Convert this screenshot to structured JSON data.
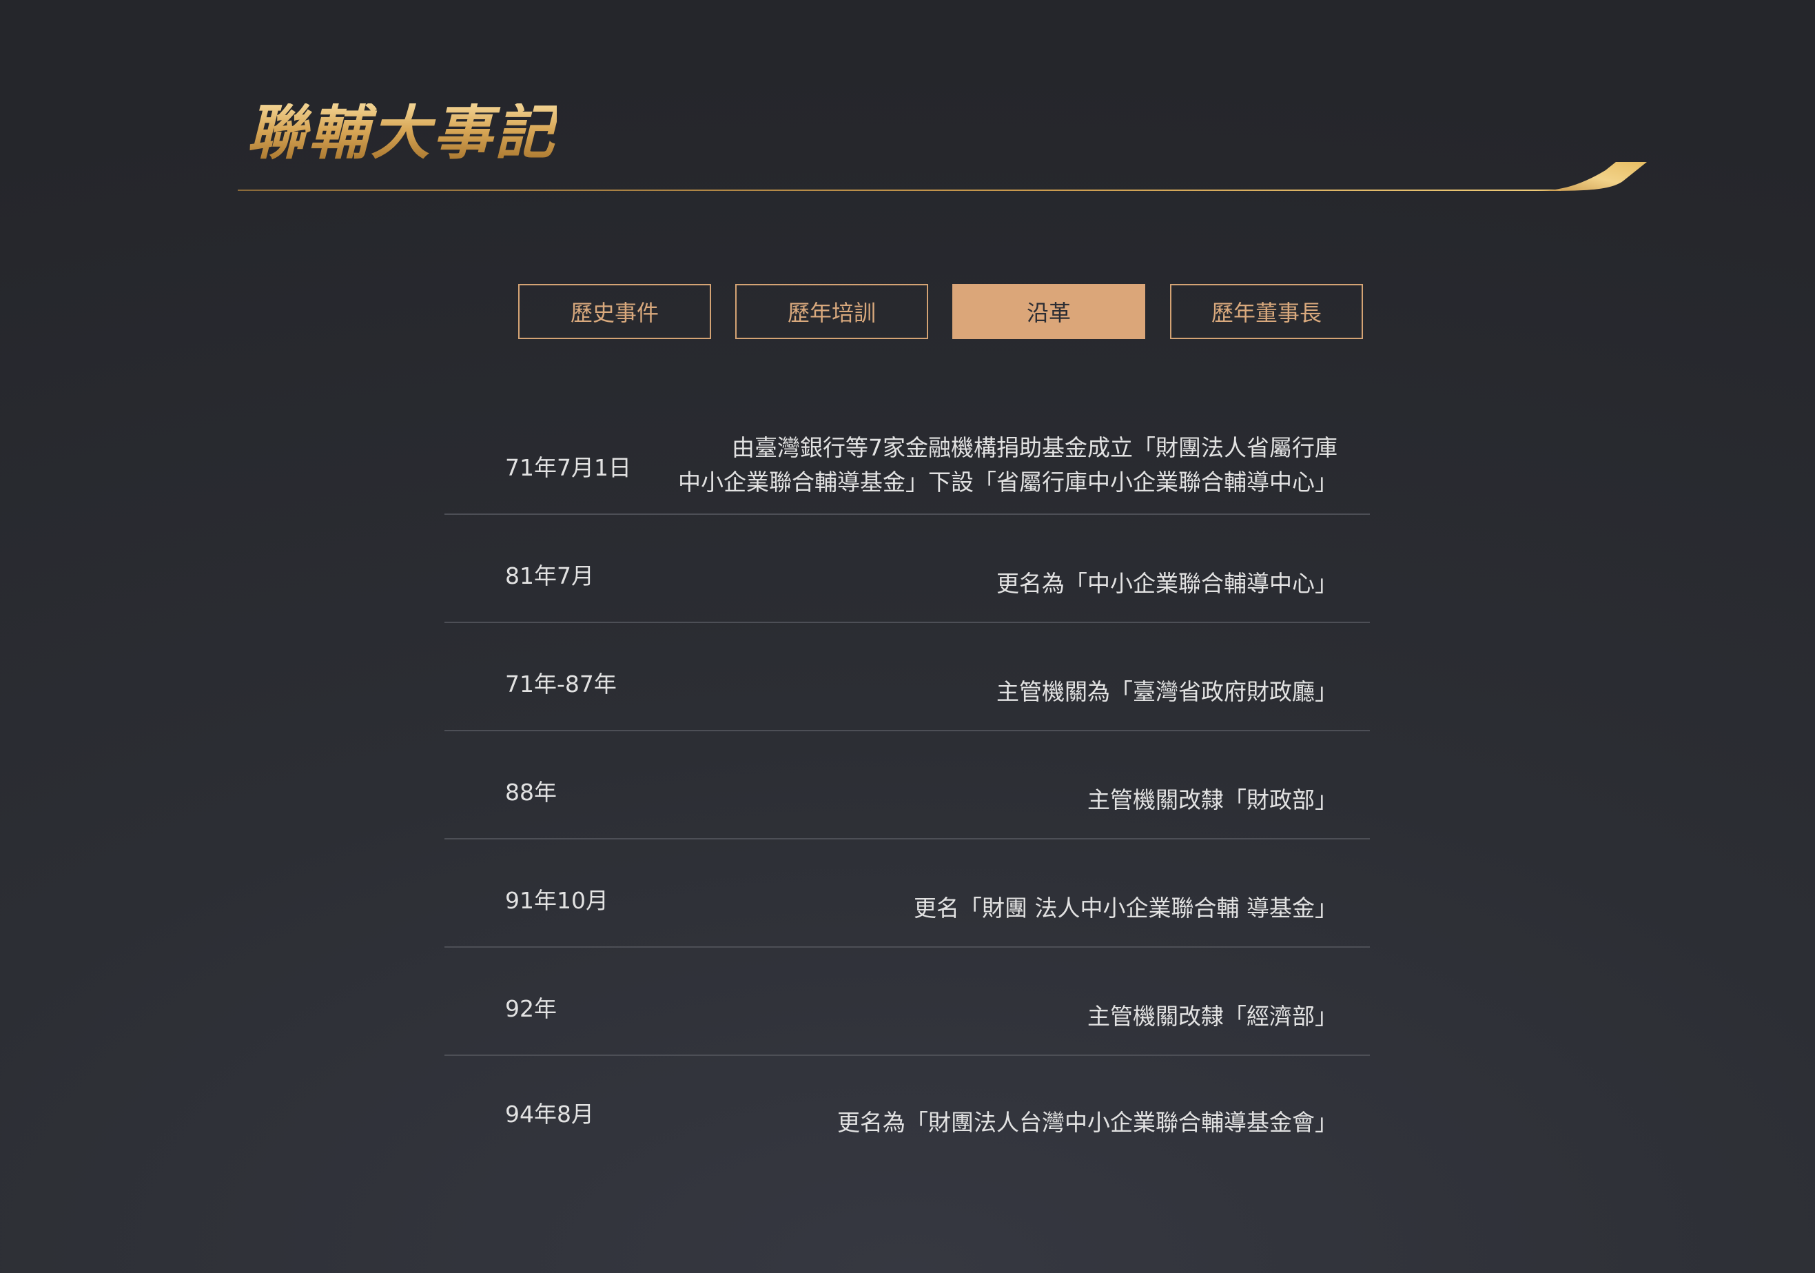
{
  "header": {
    "title": "聯輔大事記"
  },
  "tabs": [
    {
      "label": "歷史事件",
      "active": false
    },
    {
      "label": "歷年培訓",
      "active": false
    },
    {
      "label": "沿革",
      "active": true
    },
    {
      "label": "歷年董事長",
      "active": false
    }
  ],
  "timeline": [
    {
      "date": "71年7月1日",
      "desc": [
        "由臺灣銀行等7家金融機構捐助基金成立「財團法人省屬行庫",
        "中小企業聯合輔導基金」下設「省屬行庫中小企業聯合輔導中心」"
      ]
    },
    {
      "date": "81年7月",
      "desc": [
        "更名為「中小企業聯合輔導中心」"
      ]
    },
    {
      "date": "71年-87年",
      "desc": [
        "主管機關為「臺灣省政府財政廳」"
      ]
    },
    {
      "date": "88年",
      "desc": [
        "主管機關改隸「財政部」"
      ]
    },
    {
      "date": "91年10月",
      "desc": [
        "更名「財團 法人中小企業聯合輔 導基金」"
      ]
    },
    {
      "date": "92年",
      "desc": [
        "主管機關改隸「經濟部」"
      ]
    },
    {
      "date": "94年8月",
      "desc": [
        "更名為「財團法人台灣中小企業聯合輔導基金會」"
      ]
    }
  ],
  "colors": {
    "accent": "#dba679",
    "gold": "#d8a757",
    "background": "#2c2e34"
  }
}
